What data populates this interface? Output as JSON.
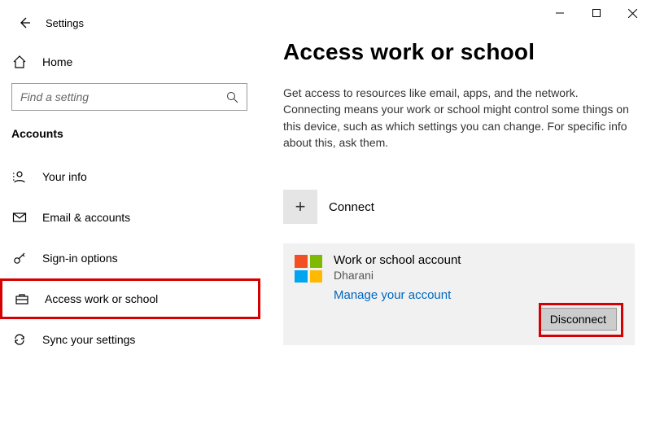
{
  "window": {
    "app_title": "Settings"
  },
  "sidebar": {
    "home_label": "Home",
    "search_placeholder": "Find a setting",
    "category": "Accounts",
    "items": [
      {
        "label": "Your info"
      },
      {
        "label": "Email & accounts"
      },
      {
        "label": "Sign-in options"
      },
      {
        "label": "Access work or school"
      },
      {
        "label": "Sync your settings"
      }
    ]
  },
  "main": {
    "title": "Access work or school",
    "description": "Get access to resources like email, apps, and the network. Connecting means your work or school might control some things on this device, such as which settings you can change. For specific info about this, ask them.",
    "connect_label": "Connect",
    "account": {
      "title": "Work or school account",
      "user": "Dharani",
      "manage_label": "Manage your account",
      "disconnect_label": "Disconnect"
    }
  }
}
